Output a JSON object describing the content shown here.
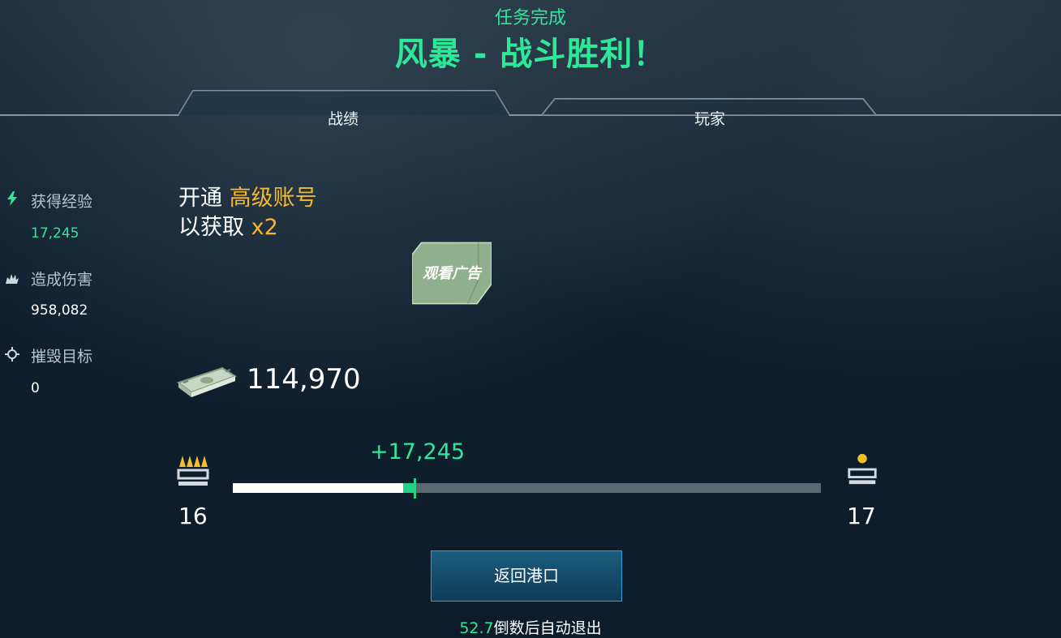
{
  "header": {
    "subtitle": "任务完成",
    "title": "风暴 - 战斗胜利！"
  },
  "tabs": [
    {
      "label": "战绩",
      "active": true
    },
    {
      "label": "玩家",
      "active": false
    }
  ],
  "stats": [
    {
      "icon": "lightning-icon",
      "label": "获得经验",
      "value": "17,245"
    },
    {
      "icon": "explosion-icon",
      "label": "造成伤害",
      "value": "958,082"
    },
    {
      "icon": "crosshair-icon",
      "label": "摧毁目标",
      "value": "0"
    }
  ],
  "promo": {
    "line1_prefix": "开通",
    "line1_highlight": "高级账号",
    "line2_prefix": "以获取",
    "line2_highlight": "x2"
  },
  "watch_ad": {
    "label": "观看广告"
  },
  "money": {
    "icon": "cash-icon",
    "value": "114,970"
  },
  "progress": {
    "gain_label": "+17,245",
    "current_rank": "16",
    "next_rank": "17",
    "base_fraction": 0.29,
    "gain_fraction": 0.02
  },
  "actions": {
    "return_label": "返回港口"
  },
  "countdown": {
    "seconds": "52.7",
    "suffix": "倒数后自动退出"
  },
  "colors": {
    "accent_green": "#2ee89a",
    "gold": "#f5b82e",
    "button_border": "#2c9ed8"
  }
}
